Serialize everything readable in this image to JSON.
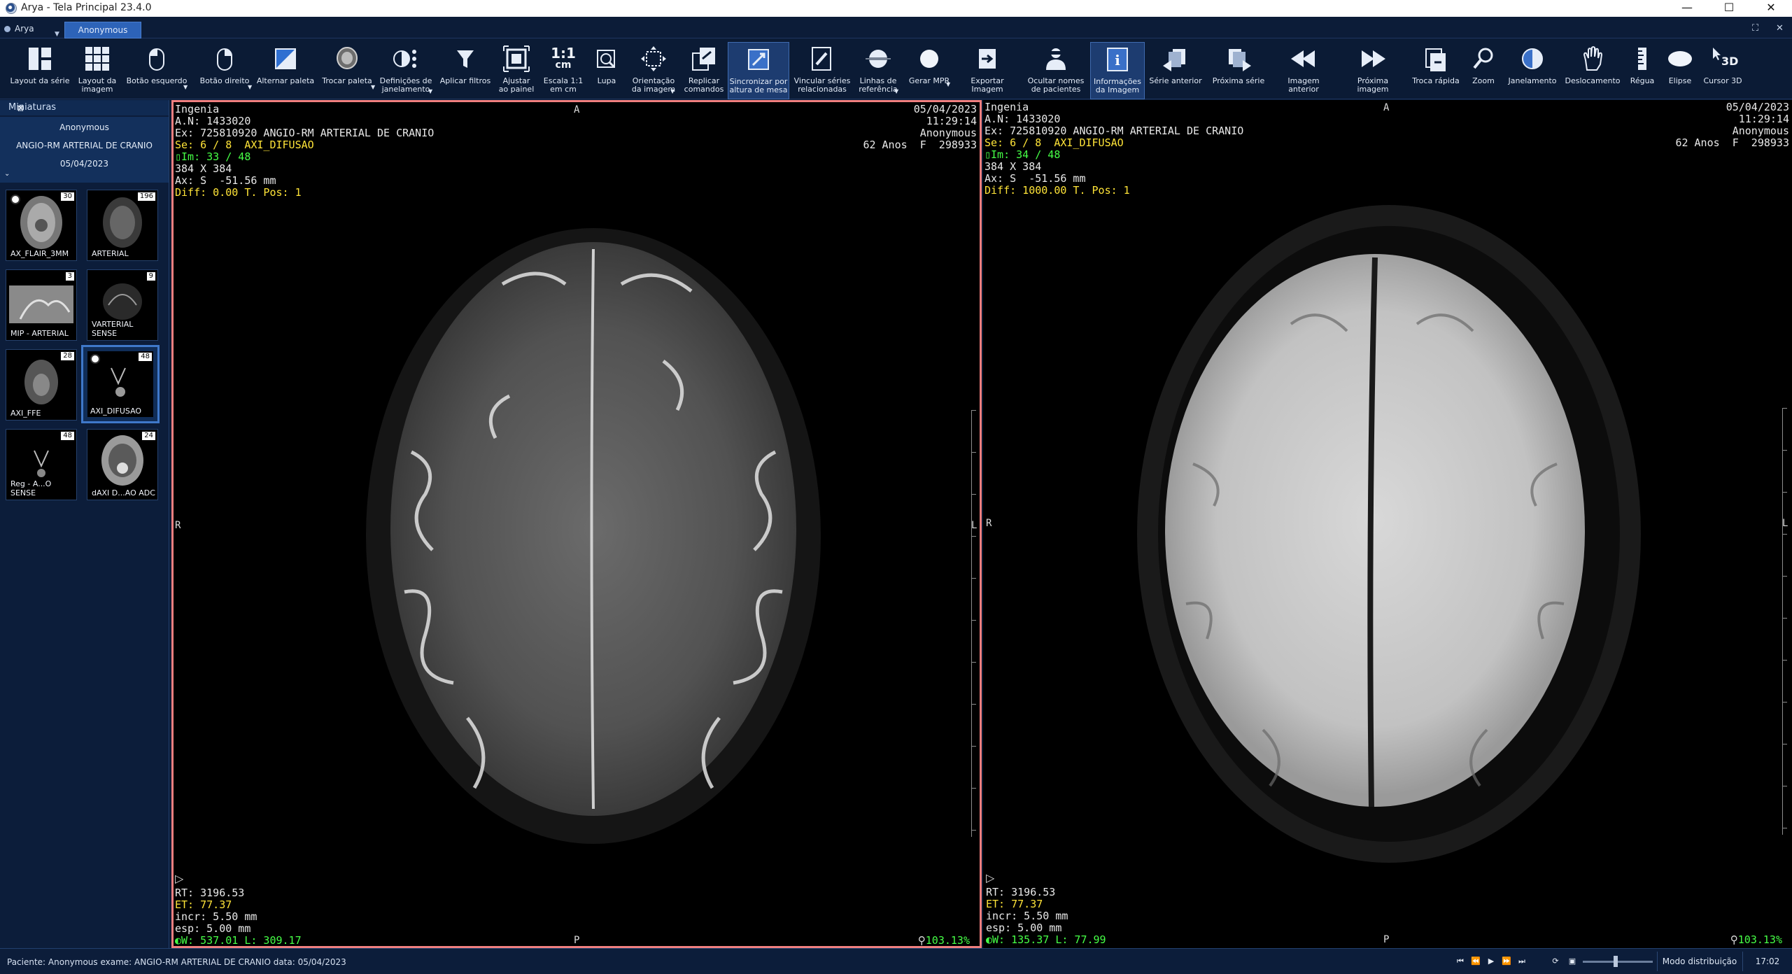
{
  "window": {
    "title": "Arya - Tela Principal 23.4.0",
    "controls": [
      "—",
      "☐",
      "✕"
    ]
  },
  "tabs": {
    "app_label": "Arya",
    "patient_tab": "Anonymous"
  },
  "toolbar": [
    {
      "id": "layout-serie",
      "line1": "Layout da série",
      "line2": "",
      "icon": "layout-series-icon"
    },
    {
      "id": "layout-imagem",
      "line1": "Layout da",
      "line2": "imagem",
      "icon": "layout-grid-icon"
    },
    {
      "id": "botao-esquerdo",
      "line1": "Botão esquerdo",
      "line2": "",
      "icon": "mouse-left-icon"
    },
    {
      "id": "botao-direito",
      "line1": "Botão direito",
      "line2": "",
      "icon": "mouse-right-icon"
    },
    {
      "id": "alternar-paleta",
      "line1": "Alternar paleta",
      "line2": "",
      "icon": "palette-toggle-icon"
    },
    {
      "id": "trocar-paleta",
      "line1": "Trocar paleta",
      "line2": "",
      "icon": "head-palette-icon"
    },
    {
      "id": "definicoes-janelamento",
      "line1": "Definições de",
      "line2": "janelamento",
      "icon": "windowing-icon"
    },
    {
      "id": "aplicar-filtros",
      "line1": "Aplicar filtros",
      "line2": "",
      "icon": "filter-icon"
    },
    {
      "id": "ajustar-painel",
      "line1": "Ajustar",
      "line2": "ao painel",
      "icon": "fit-panel-icon"
    },
    {
      "id": "escala",
      "line1": "Escala 1:1",
      "line2": "em cm",
      "icon": "scale-icon"
    },
    {
      "id": "lupa",
      "line1": "Lupa",
      "line2": "",
      "icon": "magnifier-icon"
    },
    {
      "id": "orientacao",
      "line1": "Orientação",
      "line2": "da imagem",
      "icon": "orientation-icon"
    },
    {
      "id": "replicar",
      "line1": "Replicar",
      "line2": "comandos",
      "icon": "replicate-icon"
    },
    {
      "id": "sincronizar",
      "line1": "Sincronizar por",
      "line2": "altura de mesa",
      "icon": "sync-icon"
    },
    {
      "id": "vincular",
      "line1": "Vincular séries",
      "line2": "relacionadas",
      "icon": "link-series-icon"
    },
    {
      "id": "linhas-ref",
      "line1": "Linhas de",
      "line2": "referência",
      "icon": "reference-lines-icon"
    },
    {
      "id": "gerar-mpr",
      "line1": "Gerar MPR",
      "line2": "",
      "icon": "mpr-icon"
    },
    {
      "id": "exportar",
      "line1": "Exportar Imagem",
      "line2": "",
      "icon": "export-icon"
    },
    {
      "id": "ocultar-nomes",
      "line1": "Ocultar nomes",
      "line2": "de pacientes",
      "icon": "hide-names-icon"
    },
    {
      "id": "info-imagem",
      "line1": "Informações",
      "line2": "da Imagem",
      "icon": "info-icon"
    },
    {
      "id": "serie-anterior",
      "line1": "Série anterior",
      "line2": "",
      "icon": "prev-series-icon"
    },
    {
      "id": "proxima-serie",
      "line1": "Próxima série",
      "line2": "",
      "icon": "next-series-icon"
    },
    {
      "id": "imagem-anterior",
      "line1": "Imagem anterior",
      "line2": "",
      "icon": "prev-image-icon"
    },
    {
      "id": "proxima-imagem",
      "line1": "Próxima imagem",
      "line2": "",
      "icon": "next-image-icon"
    },
    {
      "id": "troca-rapida",
      "line1": "Troca rápida",
      "line2": "",
      "icon": "quick-swap-icon"
    },
    {
      "id": "zoom",
      "line1": "Zoom",
      "line2": "",
      "icon": "zoom-icon"
    },
    {
      "id": "janelamento",
      "line1": "Janelamento",
      "line2": "",
      "icon": "contrast-icon"
    },
    {
      "id": "deslocamento",
      "line1": "Deslocamento",
      "line2": "",
      "icon": "pan-hand-icon"
    },
    {
      "id": "regua",
      "line1": "Régua",
      "line2": "",
      "icon": "ruler-icon"
    },
    {
      "id": "elipse",
      "line1": "Elipse",
      "line2": "",
      "icon": "ellipse-icon"
    },
    {
      "id": "cursor3d",
      "line1": "Cursor 3D",
      "line2": "",
      "icon": "cursor-3d-icon"
    }
  ],
  "toolbar_glyphs": {
    "scale_top": "1:1",
    "scale_bottom": "cm",
    "cursor3d": "3D"
  },
  "sidebar": {
    "header": "Miniaturas",
    "patient": {
      "name": "Anonymous",
      "exam": "ANGIO-RM ARTERIAL DE CRANIO",
      "date": "05/04/2023"
    },
    "thumbnails": [
      {
        "label": "AX_FLAIR_3MM",
        "count": "30"
      },
      {
        "label": "ARTERIAL",
        "count": "196"
      },
      {
        "label": "MIP - ARTERIAL",
        "count": "3"
      },
      {
        "label": "VARTERIAL SENSE",
        "count": "9"
      },
      {
        "label": "AXI_FFE",
        "count": "28"
      },
      {
        "label": "AXI_DIFUSAO",
        "count": "48"
      },
      {
        "label": "Reg - A...O SENSE",
        "count": "48"
      },
      {
        "label": "dAXI D...AO ADC",
        "count": "24"
      }
    ]
  },
  "viewports": [
    {
      "institution": "Ingenia",
      "an": "A.N: 1433020",
      "exam": "Ex: 725810920 ANGIO-RM ARTERIAL DE CRANIO",
      "series": "Se: 6 / 8  AXI_DIFUSAO",
      "image": "Im: 33 / 48",
      "matrix": "384 X 384",
      "position": "Ax: S  -51.56 mm",
      "diff": "Diff: 0.00 T. Pos: 1",
      "date": "05/04/2023",
      "time": "11:29:14",
      "patient": "Anonymous",
      "age": "62 Anos  F  298933",
      "rt": "RT: 3196.53",
      "et": "ET: 77.37",
      "incr": "incr: 5.50 mm",
      "esp": "esp: 5.00 mm",
      "wl": "W: 537.01 L: 309.17",
      "zoom": "103.13%",
      "orient": {
        "top": "A",
        "bottom": "P",
        "left": "R",
        "right": "L"
      }
    },
    {
      "institution": "Ingenia",
      "an": "A.N: 1433020",
      "exam": "Ex: 725810920 ANGIO-RM ARTERIAL DE CRANIO",
      "series": "Se: 6 / 8  AXI_DIFUSAO",
      "image": "Im: 34 / 48",
      "matrix": "384 X 384",
      "position": "Ax: S  -51.56 mm",
      "diff": "Diff: 1000.00 T. Pos: 1",
      "date": "05/04/2023",
      "time": "11:29:14",
      "patient": "Anonymous",
      "age": "62 Anos  F  298933",
      "rt": "RT: 3196.53",
      "et": "ET: 77.37",
      "incr": "incr: 5.50 mm",
      "esp": "esp: 5.00 mm",
      "wl": "W: 135.37 L: 77.99",
      "zoom": "103.13%",
      "orient": {
        "top": "A",
        "bottom": "P",
        "left": "R",
        "right": "L"
      }
    }
  ],
  "statusbar": {
    "text": "Paciente: Anonymous exame: ANGIO-RM ARTERIAL DE CRANIO data: 05/04/2023",
    "mode": "Modo distribuição",
    "clock": "17:02"
  },
  "colors": {
    "accent": "#2d63b8",
    "active_border": "#f07f7f",
    "overlay_yellow": "#ffe438",
    "overlay_green": "#46ff46"
  }
}
